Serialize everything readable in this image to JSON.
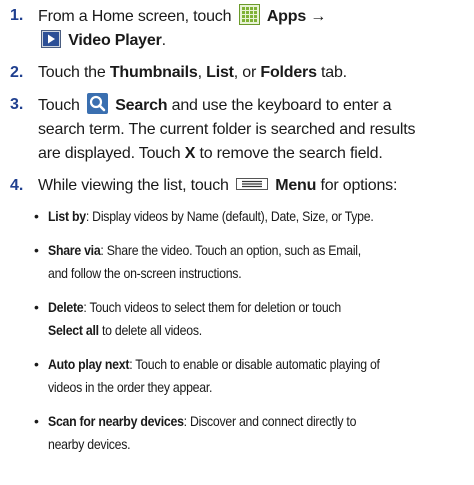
{
  "steps": [
    {
      "number": "1.",
      "part1": "From a Home screen, touch",
      "apps_label": "Apps →",
      "video_player_label": "Video Player",
      "video_player_suffix": "."
    },
    {
      "number": "2.",
      "prefix": "Touch the ",
      "thumbnails": "Thumbnails",
      "sep1": ", ",
      "list": "List",
      "sep2": ", or ",
      "folders": "Folders",
      "suffix": " tab."
    },
    {
      "number": "3.",
      "prefix": "Touch",
      "search": "Search",
      "rest_line1": " and use the keyboard to enter a",
      "line2": "search term. The current folder is searched and results",
      "line3_prefix": "are displayed. Touch ",
      "x_label": "X",
      "line3_suffix": " to remove the search field."
    },
    {
      "number": "4.",
      "prefix": "While viewing the list, touch",
      "menu": "Menu",
      "suffix": " for options:"
    }
  ],
  "bullets": [
    {
      "term": "List by",
      "line1": ": Display videos by Name (default), Date, Size, or Type."
    },
    {
      "term": "Share via",
      "line1": ": Share the video. Touch an option, such as Email,",
      "line2": "and follow the on-screen instructions."
    },
    {
      "term": "Delete",
      "line1": ": Touch videos to select them for deletion or touch",
      "line2_bold": "Select all",
      "line2": " to delete all videos."
    },
    {
      "term": "Auto play next",
      "line1": ": Touch to enable or disable automatic playing of",
      "line2": "videos in the order they appear."
    },
    {
      "term": "Scan for nearby devices",
      "line1": ": Discover and connect directly to",
      "line2": "nearby devices."
    }
  ],
  "bullet_glyph": "•",
  "icons": {
    "apps": "apps-grid-icon",
    "video_player": "video-player-icon",
    "search": "search-icon",
    "menu": "menu-icon"
  },
  "colors": {
    "step_number": "#1f3f8f",
    "apps_icon_border": "#6a9a2a",
    "search_icon_bg": "#3a6fb0"
  }
}
